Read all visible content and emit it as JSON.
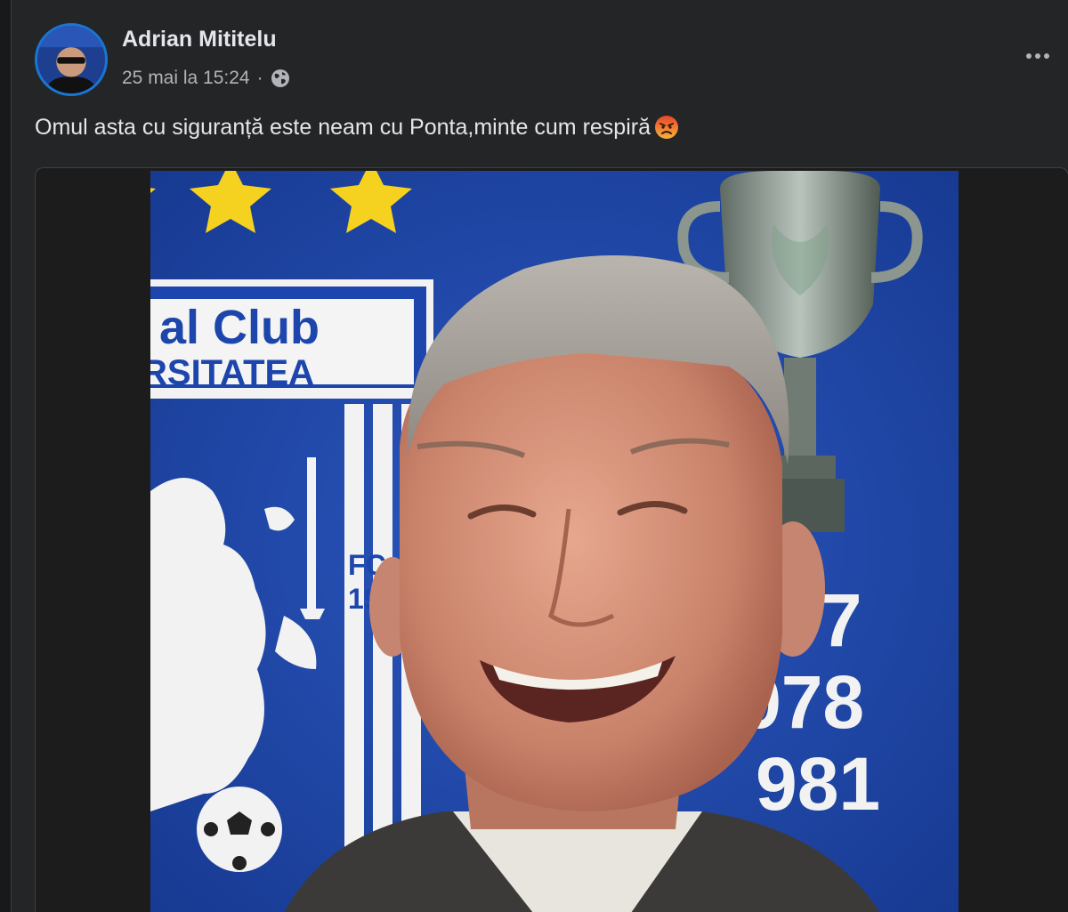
{
  "post": {
    "author": "Adrian Mititelu",
    "date": "25 mai la 15:24",
    "separator": "·",
    "privacy_icon": "globe-icon",
    "text": "Omul asta cu siguranță este neam cu Ponta,minte cum respiră",
    "emoji": "angry-face-emoji"
  },
  "photo": {
    "logo_line1": "al Club",
    "logo_line2": "RSITATEA",
    "founded_prefix": "FC",
    "founded_year": "19",
    "years": [
      "77",
      "978",
      "981"
    ]
  },
  "colors": {
    "page_bg": "#18191a",
    "card_bg": "#242526",
    "text_primary": "#e4e6eb",
    "text_secondary": "#b0b3b8",
    "club_blue": "#1f44a2",
    "star_yellow": "#f5d21f"
  }
}
